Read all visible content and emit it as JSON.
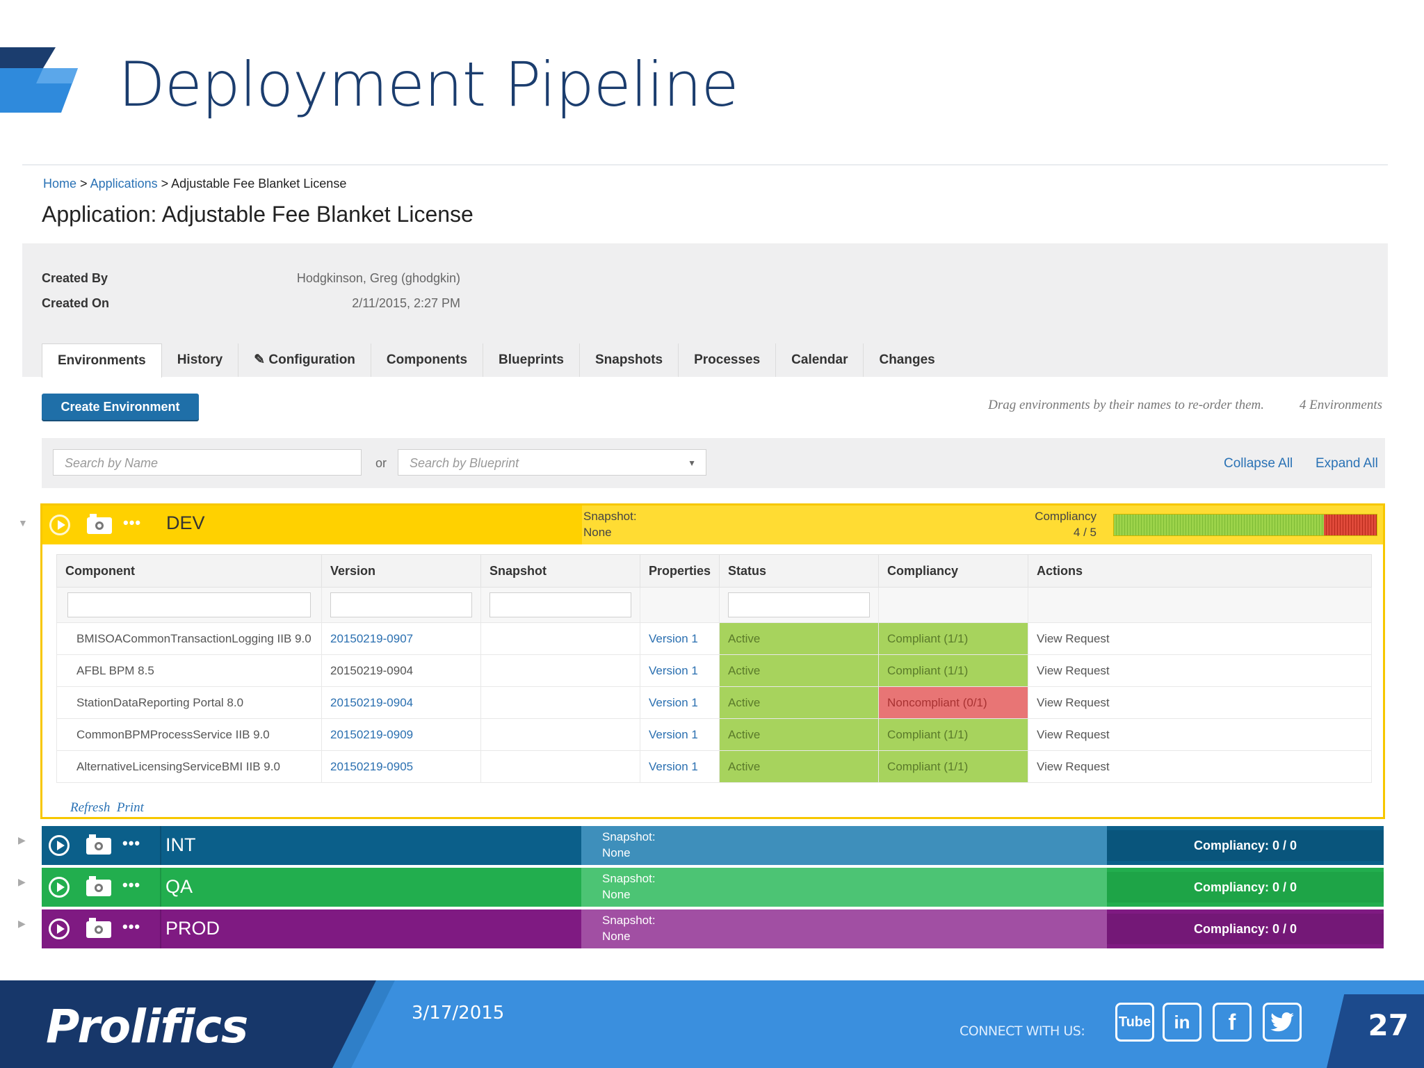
{
  "slide": {
    "title": "Deployment Pipeline"
  },
  "breadcrumb": {
    "home": "Home",
    "sep1": ">",
    "applications": "Applications",
    "sep2": ">",
    "current": "Adjustable Fee Blanket License"
  },
  "app": {
    "title": "Application: Adjustable Fee Blanket License",
    "created_by_label": "Created By",
    "created_by_value": "Hodgkinson, Greg (ghodgkin)",
    "created_on_label": "Created On",
    "created_on_value": "2/11/2015, 2:27 PM"
  },
  "tabs": [
    "Environments",
    "History",
    "Configuration",
    "Components",
    "Blueprints",
    "Snapshots",
    "Processes",
    "Calendar",
    "Changes"
  ],
  "toolbar": {
    "create_label": "Create Environment",
    "drag_hint": "Drag environments by their names to re-order them.",
    "env_count": "4 Environments"
  },
  "search": {
    "name_placeholder": "Search by Name",
    "or_label": "or",
    "blueprint_placeholder": "Search by Blueprint",
    "collapse_all": "Collapse All",
    "expand_all": "Expand All"
  },
  "icons": {
    "play": "play-circle-icon",
    "camera": "camera-icon",
    "more": "more-dots-icon",
    "expand": "expand-arrow-icon"
  },
  "environments": [
    {
      "name": "DEV",
      "snapshot_label": "Snapshot:",
      "snapshot_value": "None",
      "compliancy_label": "Compliancy",
      "compliancy_value": "4 / 5",
      "compliant_fraction": 0.8,
      "color": "#ffd100"
    },
    {
      "name": "INT",
      "snapshot_label": "Snapshot:",
      "snapshot_value": "None",
      "compliancy": "Compliancy: 0 / 0",
      "color": "#0b5f8a"
    },
    {
      "name": "QA",
      "snapshot_label": "Snapshot:",
      "snapshot_value": "None",
      "compliancy": "Compliancy: 0 / 0",
      "color": "#22ae4e"
    },
    {
      "name": "PROD",
      "snapshot_label": "Snapshot:",
      "snapshot_value": "None",
      "compliancy": "Compliancy: 0 / 0",
      "color": "#7f1a82"
    }
  ],
  "table": {
    "headers": [
      "Component",
      "Version",
      "Snapshot",
      "Properties",
      "Status",
      "Compliancy",
      "Actions"
    ],
    "rows": [
      {
        "component": "BMISOACommonTransactionLogging IIB 9.0",
        "version": "20150219-0907",
        "version_link": true,
        "snapshot": "",
        "properties": "Version 1",
        "status": "Active",
        "compliancy": "Compliant (1/1)",
        "compliant": true,
        "action": "View Request"
      },
      {
        "component": "AFBL BPM 8.5",
        "version": "20150219-0904",
        "version_link": false,
        "snapshot": "",
        "properties": "Version 1",
        "status": "Active",
        "compliancy": "Compliant (1/1)",
        "compliant": true,
        "action": "View Request"
      },
      {
        "component": "StationDataReporting Portal 8.0",
        "version": "20150219-0904",
        "version_link": true,
        "snapshot": "",
        "properties": "Version 1",
        "status": "Active",
        "compliancy": "Noncompliant (0/1)",
        "compliant": false,
        "action": "View Request"
      },
      {
        "component": "CommonBPMProcessService IIB 9.0",
        "version": "20150219-0909",
        "version_link": true,
        "snapshot": "",
        "properties": "Version 1",
        "status": "Active",
        "compliancy": "Compliant (1/1)",
        "compliant": true,
        "action": "View Request"
      },
      {
        "component": "AlternativeLicensingServiceBMI IIB 9.0",
        "version": "20150219-0905",
        "version_link": true,
        "snapshot": "",
        "properties": "Version 1",
        "status": "Active",
        "compliancy": "Compliant (1/1)",
        "compliant": true,
        "action": "View Request"
      }
    ],
    "refresh": "Refresh",
    "print": "Print"
  },
  "footer": {
    "logo": "Prolifics",
    "date": "3/17/2015",
    "connect": "CONNECT WITH US:",
    "social": [
      "Tube",
      "in",
      "f",
      "t"
    ],
    "page": "27"
  }
}
